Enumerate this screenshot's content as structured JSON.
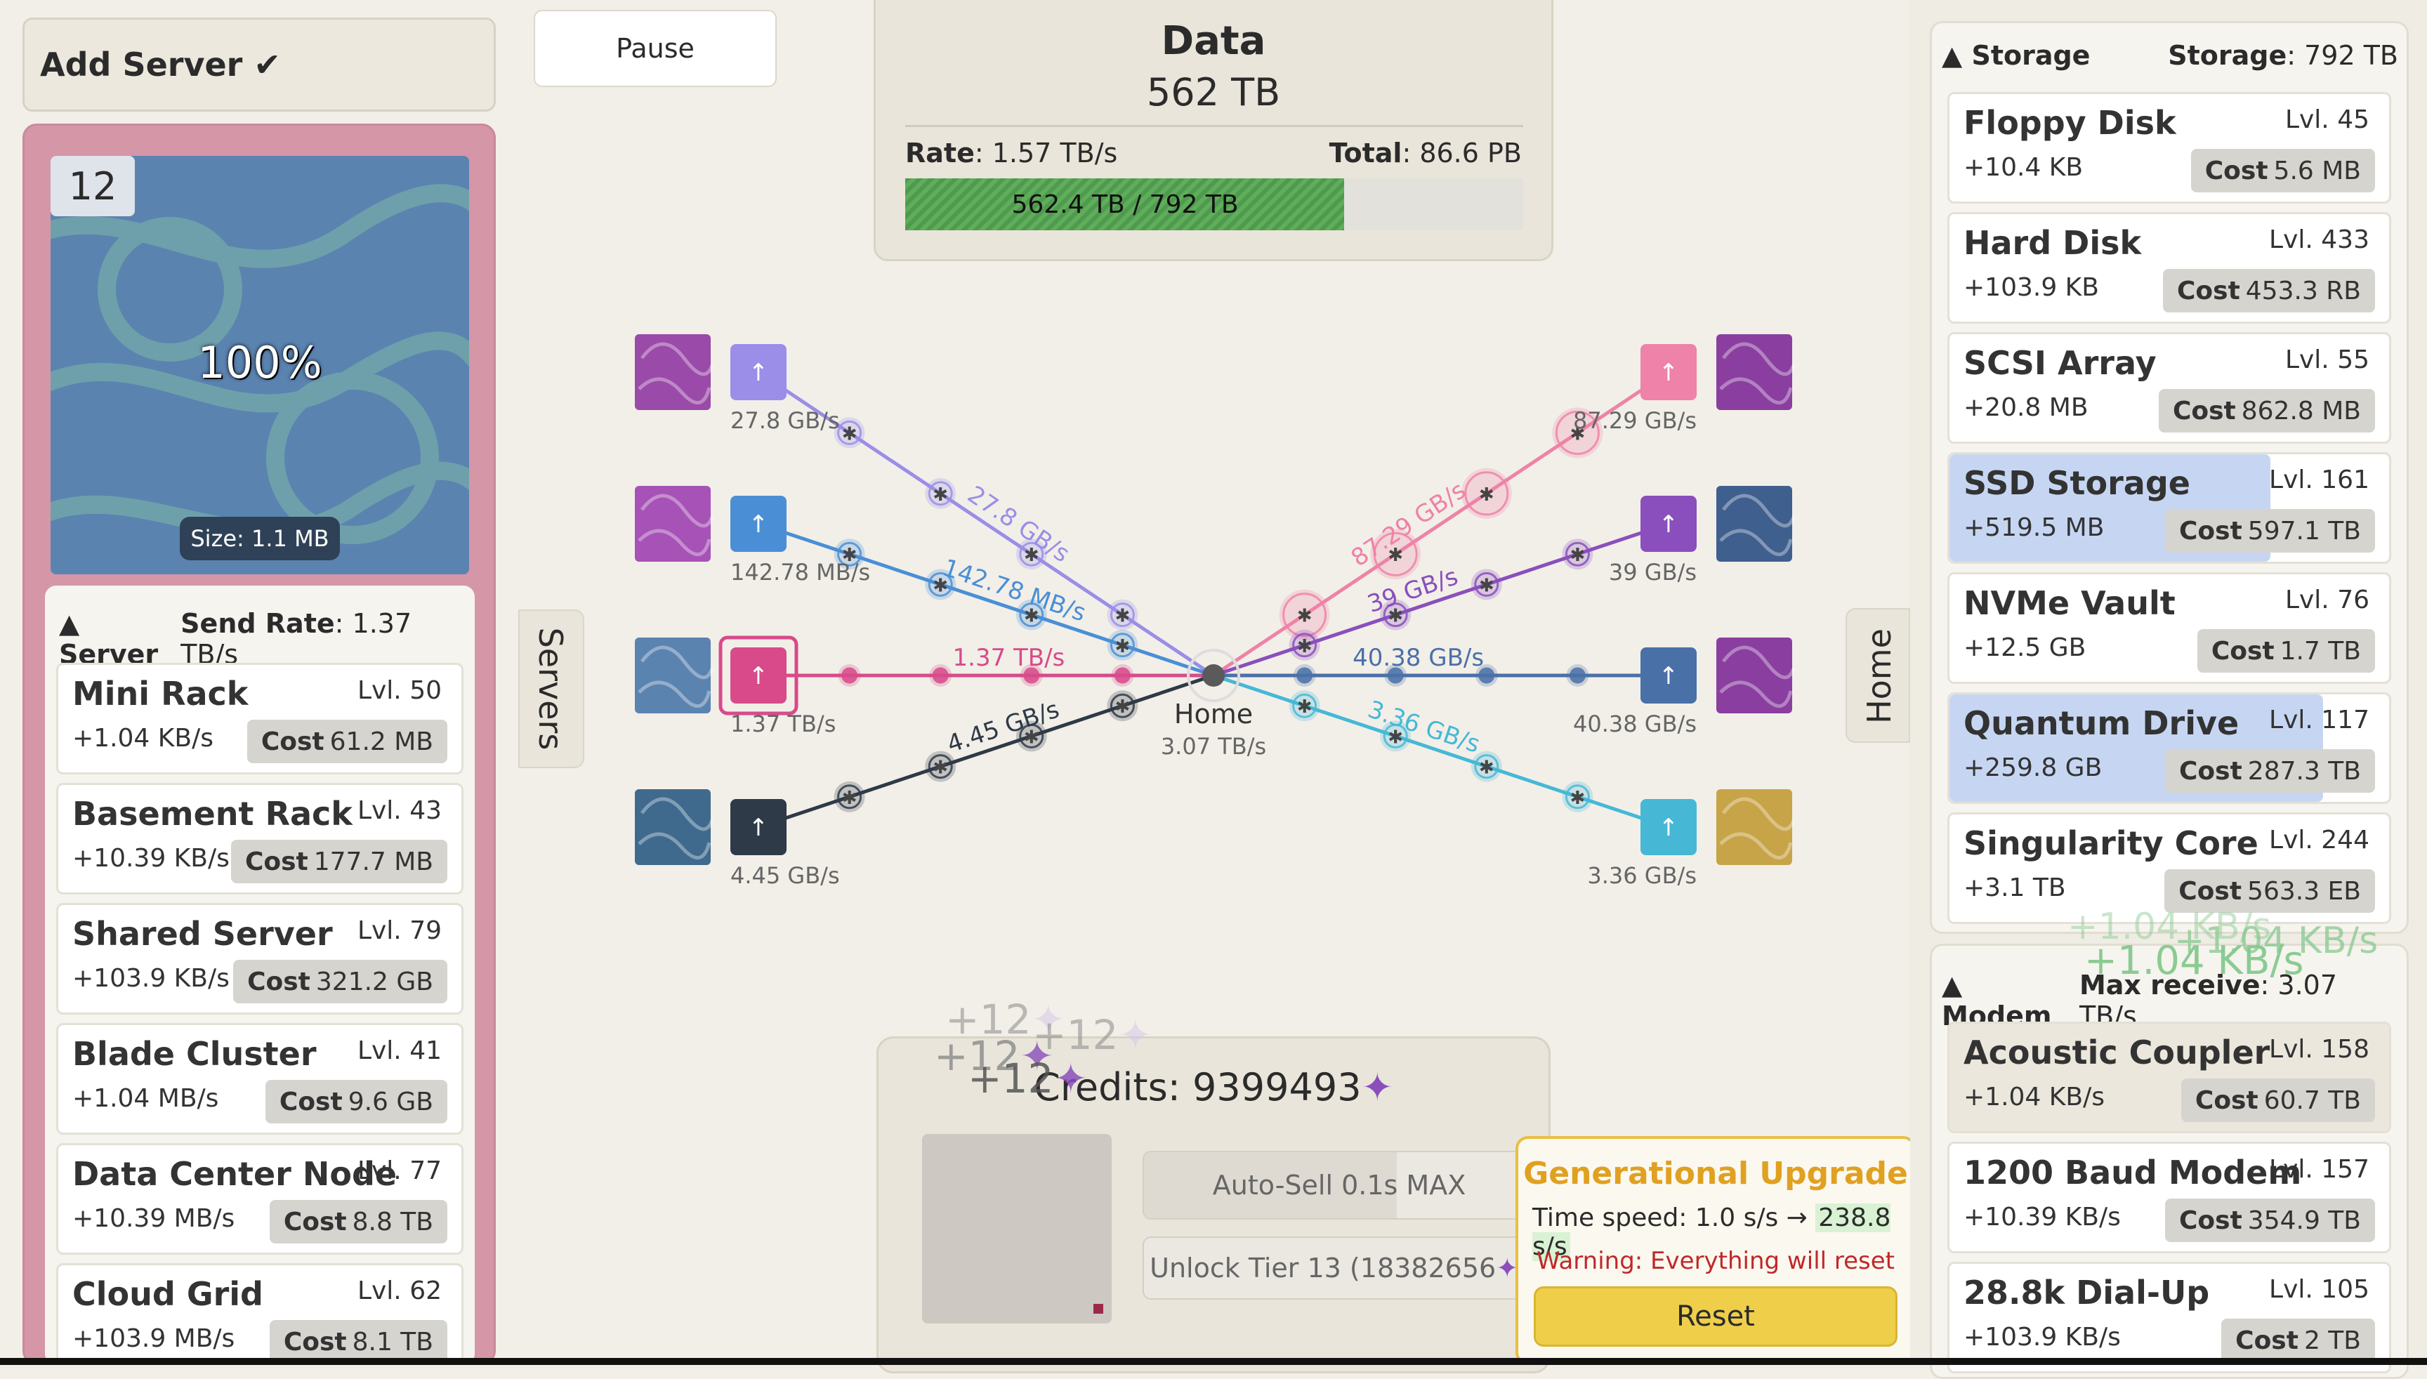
{
  "left": {
    "add_server_label": "Add Server ✔",
    "tier": "12",
    "percent": "100%",
    "size_label": "Size: 1.1 MB",
    "server_section": {
      "title": "▲ Server",
      "send_rate_label": "Send Rate",
      "send_rate_value": ": 1.37 TB/s"
    },
    "upgrades": [
      {
        "name": "Mini Rack",
        "level": "Lvl. 50",
        "gain": "+1.04 KB/s",
        "cost": "61.2 MB"
      },
      {
        "name": "Basement Rack",
        "level": "Lvl. 43",
        "gain": "+10.39 KB/s",
        "cost": "177.7 MB"
      },
      {
        "name": "Shared Server",
        "level": "Lvl. 79",
        "gain": "+103.9 KB/s",
        "cost": "321.2 GB"
      },
      {
        "name": "Blade Cluster",
        "level": "Lvl. 41",
        "gain": "+1.04 MB/s",
        "cost": "9.6 GB"
      },
      {
        "name": "Data Center Node",
        "level": "Lvl. 77",
        "gain": "+10.39 MB/s",
        "cost": "8.8 TB"
      },
      {
        "name": "Cloud Grid",
        "level": "Lvl. 62",
        "gain": "+103.9 MB/s",
        "cost": "8.1 TB"
      }
    ],
    "cost_label": "Cost"
  },
  "top": {
    "pause_label": "Pause",
    "data_title": "Data",
    "data_value": "562 TB",
    "rate_label": "Rate",
    "rate_value": ": 1.57 TB/s",
    "total_label": "Total",
    "total_value": ": 86.6 PB",
    "bar_text": "562.4 TB / 792 TB",
    "bar_fill": 0.71
  },
  "tabs": {
    "servers": "Servers",
    "home": "Home"
  },
  "network": {
    "home_label": "Home",
    "home_rate": "3.07 TB/s",
    "up_arrow": "↑",
    "left_nodes": [
      {
        "rate": "27.8 GB/s",
        "line_label": "27.8 GB/s",
        "color": "#9a8ee8"
      },
      {
        "rate": "142.78 MB/s",
        "line_label": "142.78 MB/s",
        "color": "#4a8fd6"
      },
      {
        "rate": "1.37 TB/s",
        "line_label": "1.37 TB/s",
        "color": "#d84a8a"
      },
      {
        "rate": "4.45 GB/s",
        "line_label": "4.45 GB/s",
        "color": "#2f3a48"
      }
    ],
    "right_nodes": [
      {
        "rate": "87.29 GB/s",
        "line_label": "87.29 GB/s",
        "color": "#ee82a8"
      },
      {
        "rate": "39 GB/s",
        "line_label": "39 GB/s",
        "color": "#8a4fbd"
      },
      {
        "rate": "40.38 GB/s",
        "line_label": "40.38 GB/s",
        "color": "#4a70a8"
      },
      {
        "rate": "3.36 GB/s",
        "line_label": "3.36 GB/s",
        "color": "#46b8d6"
      }
    ]
  },
  "bottom": {
    "credits_label": "Credits: 9399493",
    "credit_icon": "✦",
    "float_plus": [
      "+12",
      "+12",
      "+12",
      "+12"
    ],
    "autosell_label": "Auto-Sell 0.1s MAX",
    "unlock_label": "Unlock Tier 13 (18382656",
    "unlock_suffix": ")"
  },
  "generational": {
    "title": "Generational Upgrade",
    "time_speed_label": "Time speed: 1.0 s/s →",
    "time_speed_new": "238.8 s/s",
    "warning": "Warning: Everything will reset",
    "reset_label": "Reset"
  },
  "right": {
    "storage_section": {
      "title": "▲ Storage",
      "stat_label": "Storage",
      "stat_value": ": 792 TB"
    },
    "storage_items": [
      {
        "name": "Floppy Disk",
        "level": "Lvl. 45",
        "gain": "+10.4 KB",
        "cost": "5.6 MB",
        "progress": 0
      },
      {
        "name": "Hard Disk",
        "level": "Lvl. 433",
        "gain": "+103.9 KB",
        "cost": "453.3 RB",
        "progress": 0
      },
      {
        "name": "SCSI Array",
        "level": "Lvl. 55",
        "gain": "+20.8 MB",
        "cost": "862.8 MB",
        "progress": 0
      },
      {
        "name": "SSD Storage",
        "level": "Lvl. 161",
        "gain": "+519.5 MB",
        "cost": "597.1 TB",
        "progress": 0.73
      },
      {
        "name": "NVMe Vault",
        "level": "Lvl. 76",
        "gain": "+12.5 GB",
        "cost": "1.7 TB",
        "progress": 0
      },
      {
        "name": "Quantum Drive",
        "level": "Lvl. 117",
        "gain": "+259.8 GB",
        "cost": "287.3 TB",
        "progress": 0.85
      },
      {
        "name": "Singularity Core",
        "level": "Lvl. 244",
        "gain": "+3.1 TB",
        "cost": "563.3 EB",
        "progress": 0
      }
    ],
    "float_gain": [
      "+1.04 KB/s",
      "+1.04 KB/s",
      "+1.04 KB/s"
    ],
    "modem_section": {
      "title": "▲ Modem",
      "stat_label": "Max receive",
      "stat_value": ": 3.07 TB/s"
    },
    "modem_items": [
      {
        "name": "Acoustic Coupler",
        "level": "Lvl. 158",
        "gain": "+1.04 KB/s",
        "cost": "60.7 TB"
      },
      {
        "name": "1200 Baud Modem",
        "level": "Lvl. 157",
        "gain": "+10.39 KB/s",
        "cost": "354.9 TB"
      },
      {
        "name": "28.8k Dial-Up",
        "level": "Lvl. 105",
        "gain": "+103.9 KB/s",
        "cost": "2 TB"
      }
    ]
  }
}
